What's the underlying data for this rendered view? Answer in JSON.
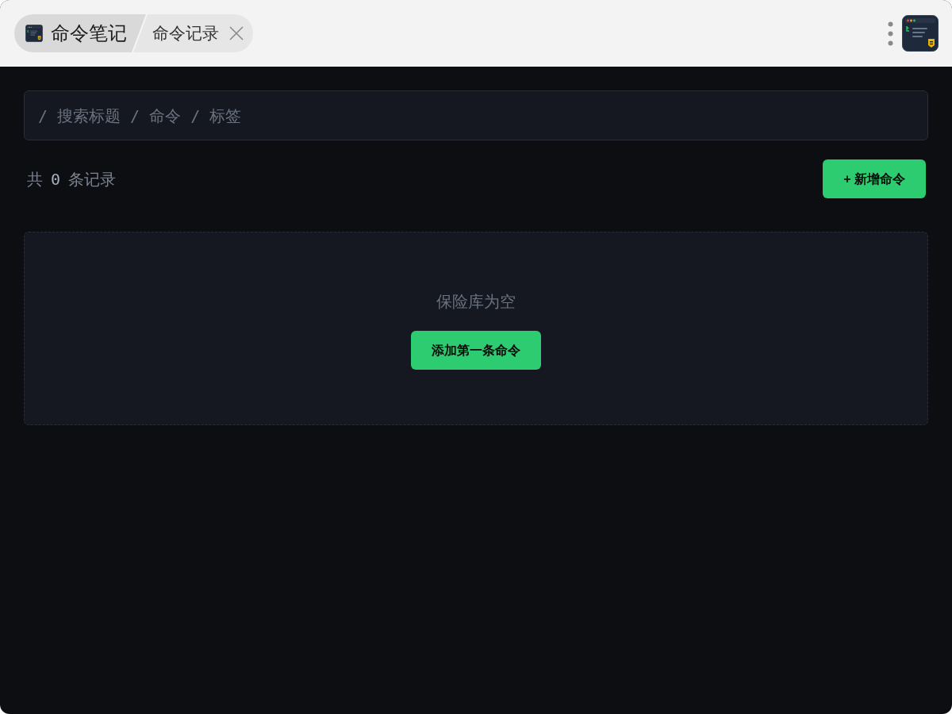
{
  "header": {
    "app_title": "命令笔记",
    "tabs": [
      {
        "label": "命令记录"
      }
    ]
  },
  "search": {
    "placeholder": "/ 搜索标题 / 命令 / 标签"
  },
  "record_count": {
    "before": "共",
    "count": "0",
    "after": "条记录"
  },
  "add_button": {
    "label": "+ 新增命令"
  },
  "empty_state": {
    "message": "保险库为空",
    "button": "添加第一条命令"
  }
}
